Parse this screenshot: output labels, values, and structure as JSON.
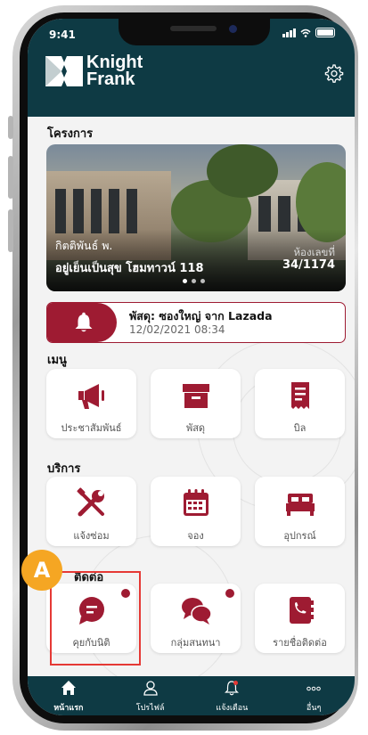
{
  "status": {
    "time": "9:41"
  },
  "header": {
    "logo_line1": "Knight",
    "logo_line2": "Frank",
    "settings_icon": "gear-icon"
  },
  "project": {
    "section_title": "โครงการ",
    "banner": {
      "subtitle": "กิตติพันธ์ พ.",
      "title": "อยู่เย็นเป็นสุข โฮมทาวน์ 118",
      "room_label": "ห้องเลขที่",
      "room_value": "34/1174",
      "page_count": 3,
      "active_page": 1
    }
  },
  "notice": {
    "title": "พัสดุ: ซองใหญ่ จาก Lazada",
    "datetime": "12/02/2021 08:34",
    "icon": "bell-icon"
  },
  "menu": {
    "section_title": "เมนู",
    "items": [
      {
        "label": "ประชาสัมพันธ์",
        "icon": "megaphone-icon"
      },
      {
        "label": "พัสดุ",
        "icon": "parcel-box-icon"
      },
      {
        "label": "บิล",
        "icon": "bill-icon"
      }
    ]
  },
  "services": {
    "section_title": "บริการ",
    "items": [
      {
        "label": "แจ้งซ่อม",
        "icon": "repair-tools-icon"
      },
      {
        "label": "จอง",
        "icon": "calendar-icon"
      },
      {
        "label": "อุปกรณ์",
        "icon": "bed-icon"
      }
    ]
  },
  "contact": {
    "section_title": "ติดต่อ",
    "items": [
      {
        "label": "คุยกับนิติ",
        "icon": "chat-bubble-icon",
        "has_notification": true
      },
      {
        "label": "กลุ่มสนทนา",
        "icon": "group-chat-icon",
        "has_notification": true
      },
      {
        "label": "รายชื่อติดต่อ",
        "icon": "phonebook-icon",
        "has_notification": false
      }
    ]
  },
  "annotation": {
    "badge": "A"
  },
  "tabbar": {
    "items": [
      {
        "label": "หน้าแรก",
        "icon": "home-icon",
        "active": true
      },
      {
        "label": "โปรไฟล์",
        "icon": "profile-icon",
        "active": false
      },
      {
        "label": "แจ้งเตือน",
        "icon": "notification-bell-icon",
        "active": false
      },
      {
        "label": "อื่นๆ",
        "icon": "more-icon",
        "active": false
      }
    ]
  },
  "colors": {
    "header_bg": "#0e3a44",
    "accent": "#9e1b32",
    "highlight": "#e53935",
    "badge": "#f5a623"
  }
}
